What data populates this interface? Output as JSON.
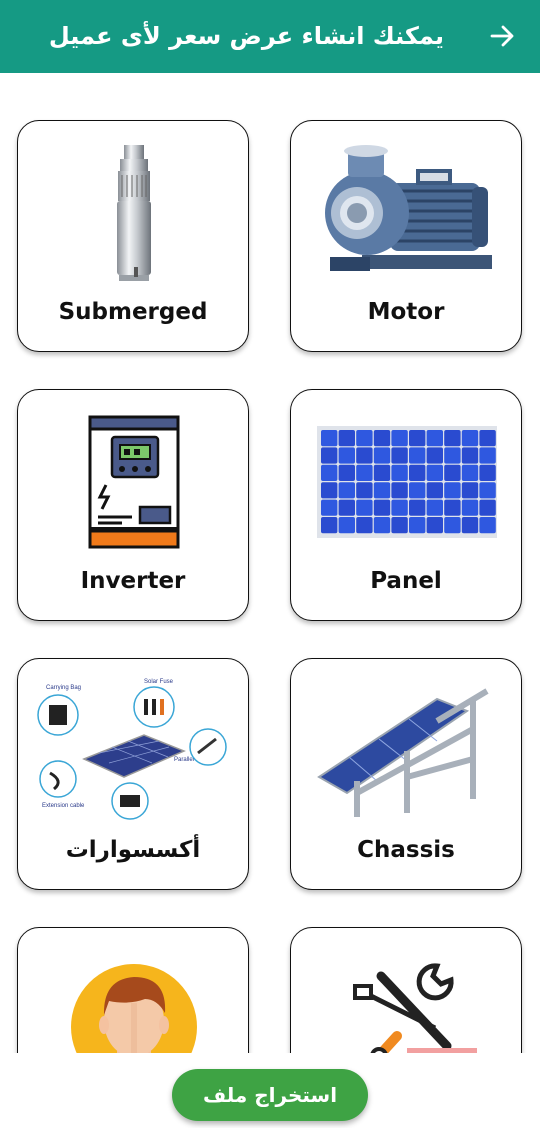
{
  "header": {
    "title": "يمكنك انشاء عرض سعر لأى عميل",
    "back_icon": "arrow-right-icon",
    "background": "#159a84"
  },
  "categories": [
    {
      "label": "Submerged",
      "icon": "submersible-pump-icon"
    },
    {
      "label": "Motor",
      "icon": "centrifugal-pump-icon"
    },
    {
      "label": "Inverter",
      "icon": "inverter-icon"
    },
    {
      "label": "Panel",
      "icon": "solar-panel-icon"
    },
    {
      "label": "أكسسوارات",
      "icon": "accessories-icon"
    },
    {
      "label": "Chassis",
      "icon": "chassis-icon"
    },
    {
      "label": "",
      "icon": "person-avatar-icon"
    },
    {
      "label": "",
      "icon": "tools-icon"
    }
  ],
  "accessories_labels": {
    "bag": "Carrying Bag",
    "fuse": "Solar Fuse",
    "parallel": "Parallel Cable",
    "extension": "Extension cable"
  },
  "footer": {
    "export_label": "استخراج ملف",
    "button_color": "#3ea344"
  }
}
